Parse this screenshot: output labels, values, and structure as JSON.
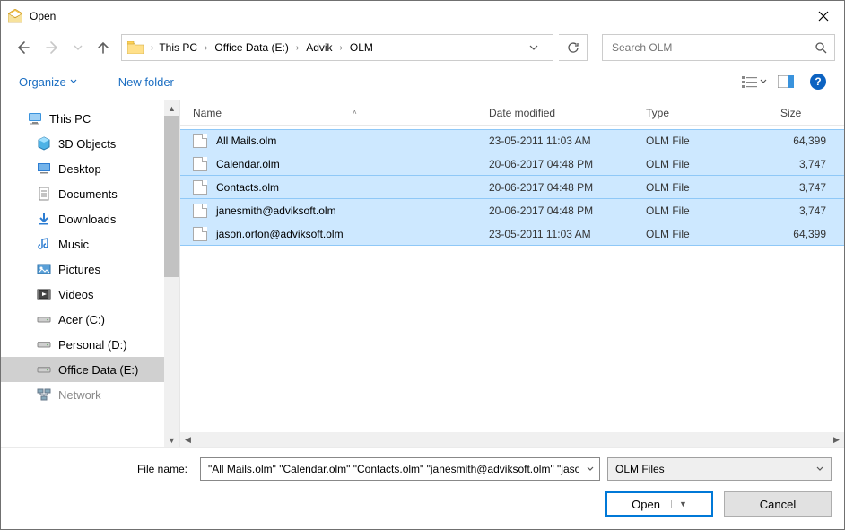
{
  "window": {
    "title": "Open"
  },
  "breadcrumbs": [
    "This PC",
    "Office Data (E:)",
    "Advik",
    "OLM"
  ],
  "search": {
    "placeholder": "Search OLM"
  },
  "toolbar": {
    "organize": "Organize",
    "new_folder": "New folder"
  },
  "navpane": {
    "root": "This PC",
    "items": [
      {
        "label": "3D Objects",
        "icon": "objects3d"
      },
      {
        "label": "Desktop",
        "icon": "desktop"
      },
      {
        "label": "Documents",
        "icon": "documents"
      },
      {
        "label": "Downloads",
        "icon": "downloads"
      },
      {
        "label": "Music",
        "icon": "music"
      },
      {
        "label": "Pictures",
        "icon": "pictures"
      },
      {
        "label": "Videos",
        "icon": "videos"
      },
      {
        "label": "Acer (C:)",
        "icon": "drive"
      },
      {
        "label": "Personal (D:)",
        "icon": "drive"
      },
      {
        "label": "Office Data (E:)",
        "icon": "drive",
        "active": true
      },
      {
        "label": "Network",
        "icon": "network",
        "dim": true
      }
    ]
  },
  "columns": {
    "name": "Name",
    "date": "Date modified",
    "type": "Type",
    "size": "Size"
  },
  "files": [
    {
      "name": "All Mails.olm",
      "date": "23-05-2011 11:03 AM",
      "type": "OLM File",
      "size": "64,399",
      "selected": true
    },
    {
      "name": "Calendar.olm",
      "date": "20-06-2017 04:48 PM",
      "type": "OLM File",
      "size": "3,747",
      "selected": true
    },
    {
      "name": "Contacts.olm",
      "date": "20-06-2017 04:48 PM",
      "type": "OLM File",
      "size": "3,747",
      "selected": true
    },
    {
      "name": "janesmith@adviksoft.olm",
      "date": "20-06-2017 04:48 PM",
      "type": "OLM File",
      "size": "3,747",
      "selected": true
    },
    {
      "name": "jason.orton@adviksoft.olm",
      "date": "23-05-2011 11:03 AM",
      "type": "OLM File",
      "size": "64,399",
      "selected": true
    }
  ],
  "bottom": {
    "filename_label": "File name:",
    "filename_value": "\"All Mails.olm\" \"Calendar.olm\" \"Contacts.olm\" \"janesmith@adviksoft.olm\" \"jason.orton@adviksoft.olm\"",
    "filter": "OLM Files",
    "open": "Open",
    "cancel": "Cancel"
  }
}
